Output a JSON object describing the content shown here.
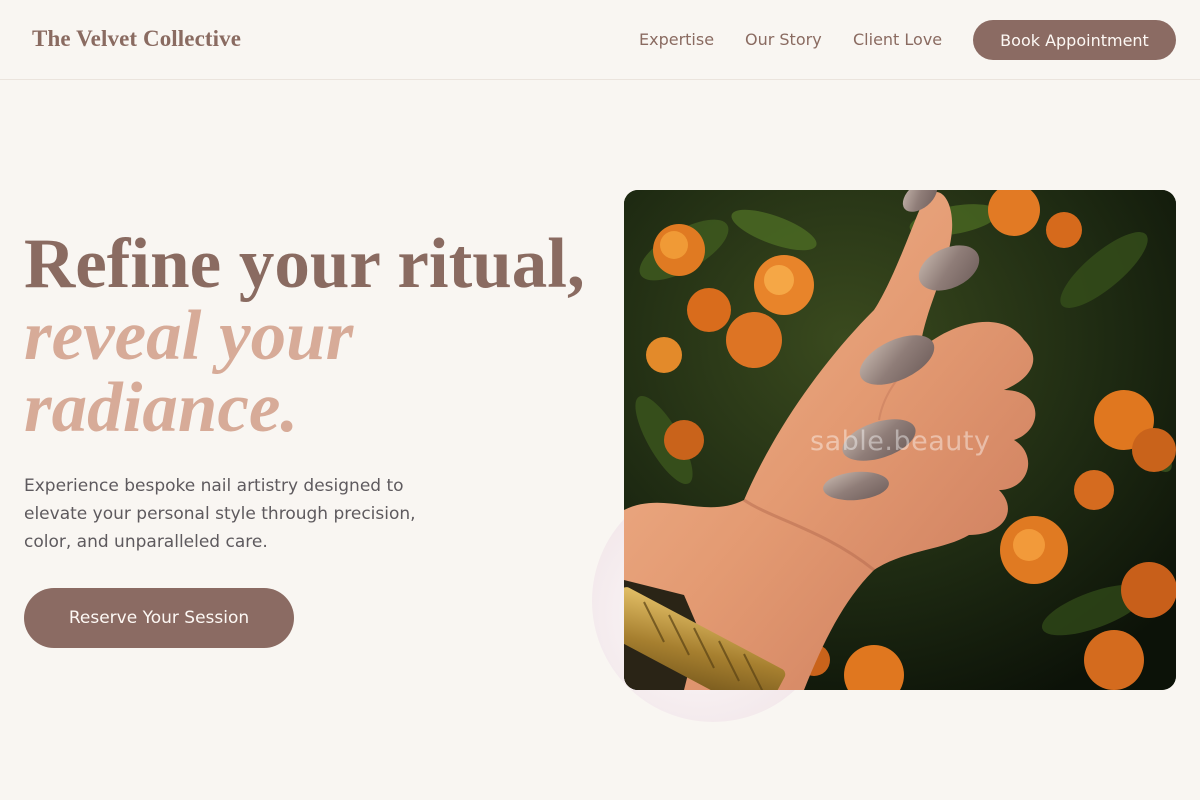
{
  "header": {
    "brand": "The Velvet Collective",
    "nav": [
      "Expertise",
      "Our Story",
      "Client Love"
    ],
    "book_label": "Book Appointment"
  },
  "hero": {
    "headline_line1": "Refine your ritual,",
    "headline_accent_line1": "reveal your",
    "headline_accent_line2": "radiance.",
    "description": "Experience bespoke nail artistry designed to elevate your personal style through precision, color, and unparalleled care.",
    "cta_label": "Reserve Your Session",
    "image_watermark": "sable.beauty"
  },
  "colors": {
    "background": "#f9f6f2",
    "brand": "#8a6b61",
    "accent": "#d7ab98",
    "button": "#8b6b63",
    "body_text": "#5e5a5e"
  }
}
